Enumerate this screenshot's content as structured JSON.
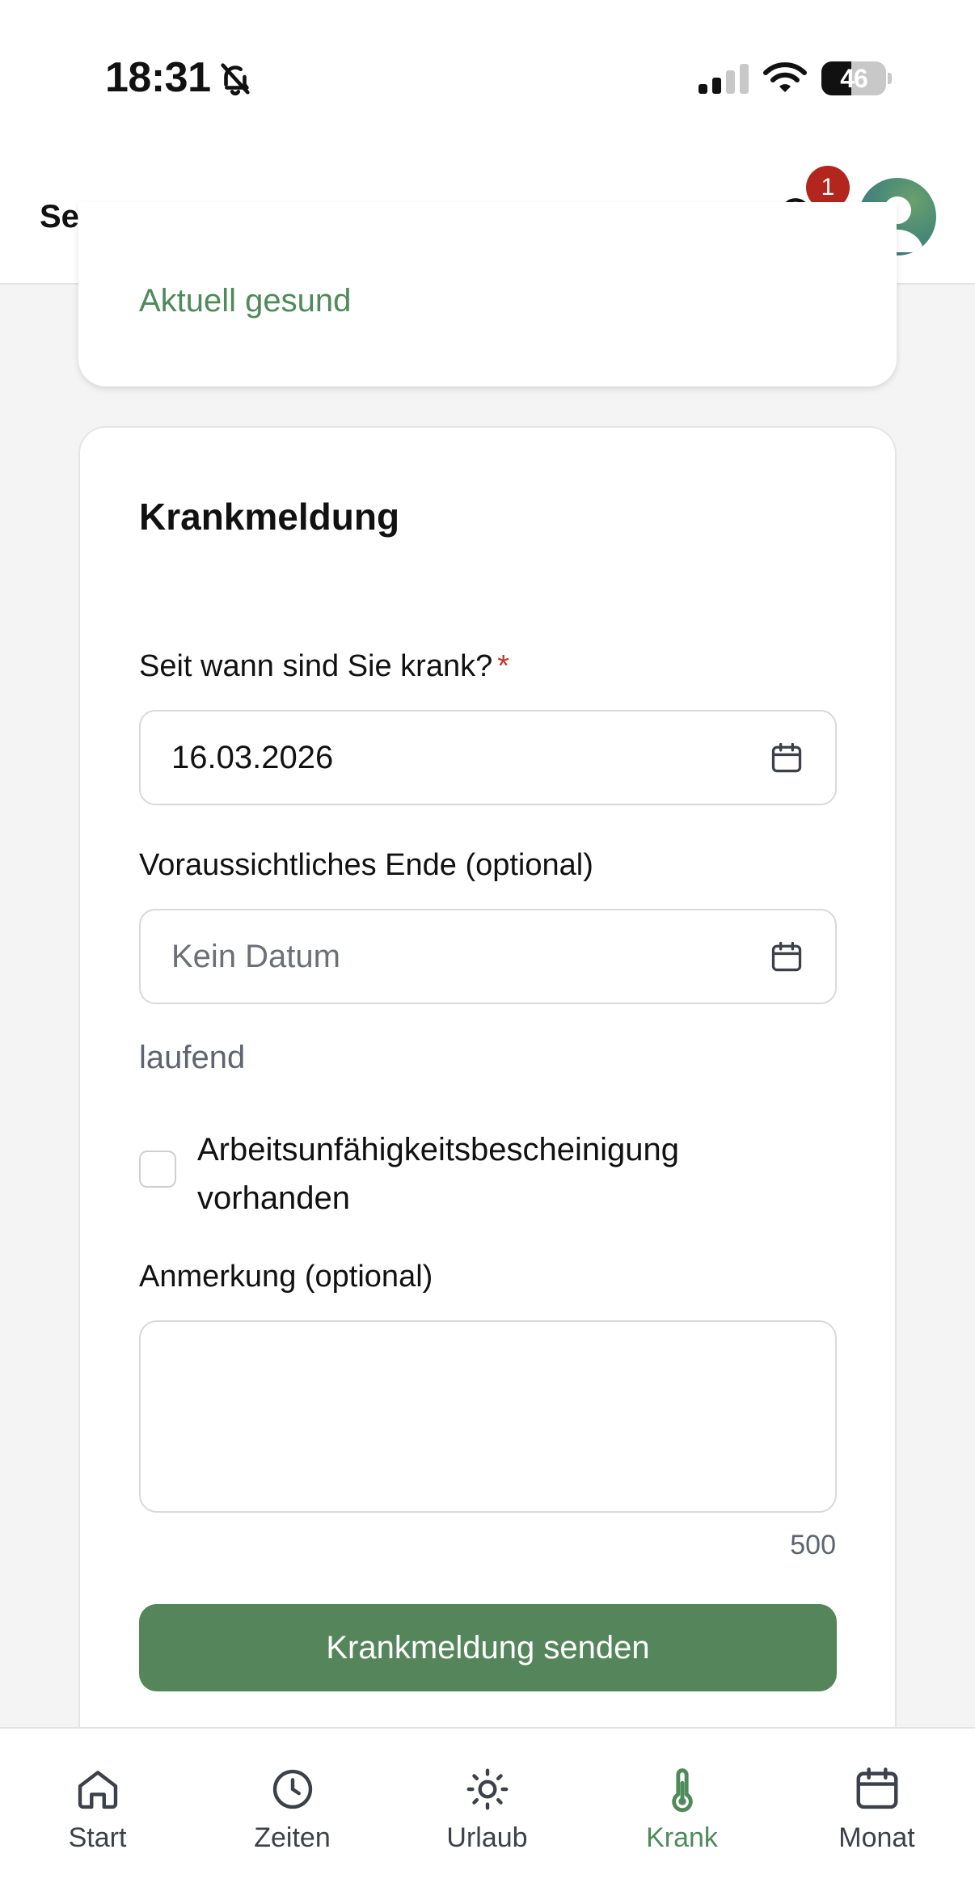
{
  "status_bar": {
    "time": "18:31",
    "battery": "46",
    "battery_level": 0.46,
    "icons": [
      "bell-slash-icon",
      "cellular-signal-icon",
      "wifi-icon",
      "battery-icon"
    ]
  },
  "header": {
    "company": "Sebbel GmbH",
    "notification_count": "1",
    "icons": [
      "bell-icon",
      "user-avatar-icon"
    ]
  },
  "status_card": {
    "status": "Aktuell gesund"
  },
  "form": {
    "title": "Krankmeldung",
    "since_label": "Seit wann sind Sie krank?",
    "required_marker": "*",
    "since_value": "16.03.2026",
    "end_label": "Voraussichtliches Ende (optional)",
    "end_placeholder": "Kein Datum",
    "end_hint": "laufend",
    "certificate_label": "Arbeitsunfähigkeitsbescheinigung vorhanden",
    "certificate_checked": false,
    "note_label": "Anmerkung (optional)",
    "note_value": "",
    "char_counter": "500",
    "submit_label": "Krankmeldung senden"
  },
  "nav": {
    "items": [
      {
        "label": "Start",
        "icon": "home-icon",
        "active": false
      },
      {
        "label": "Zeiten",
        "icon": "clock-icon",
        "active": false
      },
      {
        "label": "Urlaub",
        "icon": "sun-icon",
        "active": false
      },
      {
        "label": "Krank",
        "icon": "thermometer-icon",
        "active": true
      },
      {
        "label": "Monat",
        "icon": "calendar-icon",
        "active": false
      }
    ]
  },
  "colors": {
    "accent": "#55855b",
    "status_green": "#4f8a5b",
    "required_red": "#c0392b",
    "badge_red": "#b3261e"
  }
}
